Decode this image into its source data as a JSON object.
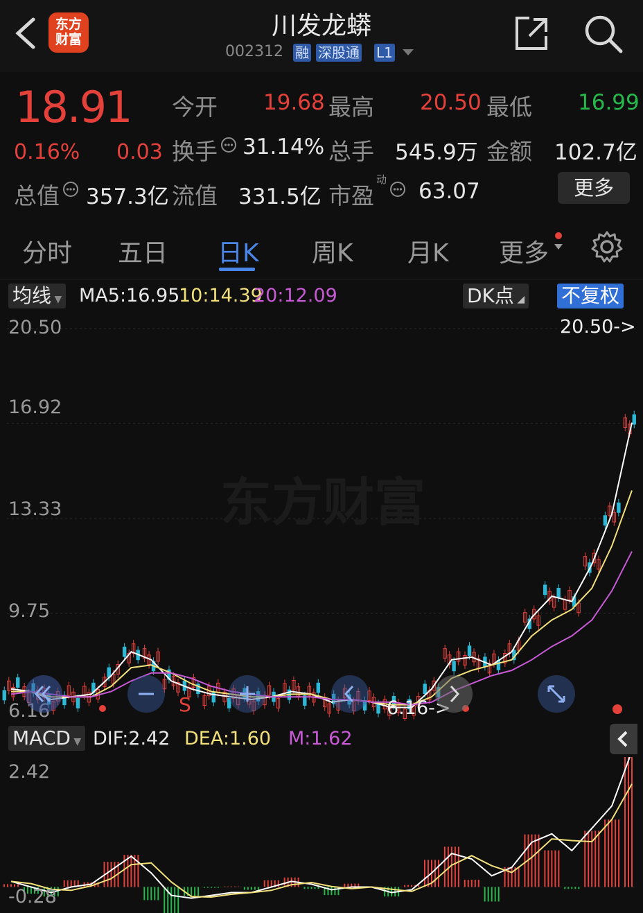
{
  "header": {
    "back_icon": "chevron-left-icon",
    "logo_text_line1": "东方",
    "logo_text_line2": "财富",
    "title": "川发龙蟒",
    "code": "002312",
    "tags": [
      "融",
      "深股通",
      "L1"
    ],
    "share_icon": "share-icon",
    "search_icon": "search-icon"
  },
  "quote": {
    "price": "18.91",
    "change_pct": "0.16%",
    "change": "0.03",
    "open_label": "今开",
    "open": "19.68",
    "high_label": "最高",
    "high": "20.50",
    "low_label": "最低",
    "low": "16.99",
    "turnover_label": "换手",
    "turnover": "31.14%",
    "volume_label": "总手",
    "volume": "545.9万",
    "amount_label": "金额",
    "amount": "102.7亿",
    "mktcap_label": "总值",
    "mktcap": "357.3亿",
    "float_label": "流值",
    "float": "331.5亿",
    "pe_label": "市盈",
    "pe_sup": "动",
    "pe": "63.07",
    "more_label": "更多",
    "colors": {
      "up": "#e5413b",
      "down": "#27b84c"
    }
  },
  "tabs": [
    {
      "label": "分时",
      "active": false
    },
    {
      "label": "五日",
      "active": false
    },
    {
      "label": "日K",
      "active": true
    },
    {
      "label": "周K",
      "active": false
    },
    {
      "label": "月K",
      "active": false
    },
    {
      "label": "更多",
      "active": false
    }
  ],
  "toolbar": {
    "ma_select": "均线",
    "ma5": "MA5:16.95",
    "ma10": "10:14.39",
    "ma20": "20:12.09",
    "dk_select": "DK点",
    "fq_button": "不复权",
    "ma_colors": {
      "ma5": "#ffffff",
      "ma10": "#f2e07a",
      "ma20": "#c85ad6"
    }
  },
  "kchart": {
    "y_labels": [
      "20.50",
      "16.92",
      "13.33",
      "9.75",
      "6.16"
    ],
    "max_label": "20.50->",
    "min_label": "6.16->",
    "sell_marker": "S",
    "watermark": "东方财富"
  },
  "macd": {
    "select": "MACD",
    "dif": "DIF:2.42",
    "dea": "DEA:1.60",
    "m": "M:1.62",
    "y_labels": [
      "2.42",
      "-0.28"
    ],
    "colors": {
      "dif": "#ffffff",
      "dea": "#f2e07a",
      "m": "#c85ad6"
    }
  },
  "chart_data": {
    "type": "line",
    "series": [
      {
        "name": "MA5",
        "values": [
          6.9,
          6.8,
          6.5,
          6.6,
          6.7,
          7.4,
          8.3,
          8.0,
          7.2,
          6.9,
          6.7,
          6.6,
          6.5,
          6.6,
          6.8,
          6.7,
          6.4,
          6.5,
          6.4,
          6.2,
          6.2,
          6.9,
          8.0,
          8.1,
          7.8,
          8.3,
          9.6,
          10.4,
          10.2,
          11.6,
          13.5,
          16.95
        ]
      },
      {
        "name": "10",
        "values": [
          6.8,
          6.8,
          6.6,
          6.6,
          6.6,
          7.0,
          7.7,
          7.8,
          7.5,
          7.1,
          6.8,
          6.7,
          6.6,
          6.6,
          6.7,
          6.7,
          6.5,
          6.5,
          6.4,
          6.3,
          6.3,
          6.6,
          7.3,
          7.6,
          7.8,
          8.0,
          8.9,
          9.5,
          9.9,
          10.7,
          12.3,
          14.39
        ]
      },
      {
        "name": "20",
        "values": [
          6.7,
          6.8,
          6.7,
          6.6,
          6.6,
          6.8,
          7.2,
          7.5,
          7.5,
          7.3,
          7.0,
          6.8,
          6.7,
          6.6,
          6.6,
          6.6,
          6.5,
          6.5,
          6.4,
          6.4,
          6.3,
          6.4,
          6.8,
          7.1,
          7.4,
          7.6,
          8.0,
          8.5,
          8.9,
          9.5,
          10.6,
          12.09
        ]
      }
    ],
    "ylim": [
      6.16,
      20.5
    ],
    "grid": true
  }
}
